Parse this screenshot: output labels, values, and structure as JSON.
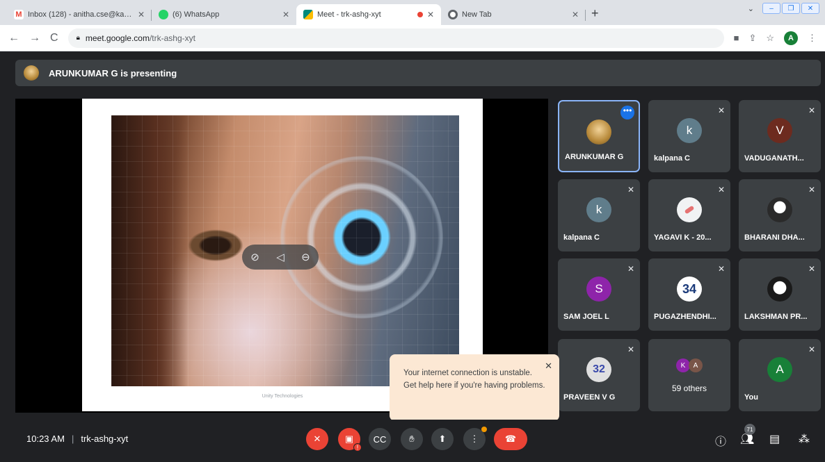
{
  "browser": {
    "tabs": [
      {
        "title": "Inbox (128) - anitha.cse@karpag",
        "icon": "gmail-icon",
        "color": "#ea4335"
      },
      {
        "title": "(6) WhatsApp",
        "icon": "whatsapp-icon",
        "color": "#25d366"
      },
      {
        "title": "Meet - trk-ashg-xyt",
        "icon": "meet-icon",
        "color": "#00897b"
      },
      {
        "title": "New Tab",
        "icon": "chrome-icon",
        "color": "#5f6368"
      }
    ],
    "url_host": "meet.google.com",
    "url_path": "/trk-ashg-xyt",
    "profile_initial": "A"
  },
  "presenting_banner": "ARUNKUMAR G is presenting",
  "slide_caption": "Unity Technologies",
  "participants": [
    {
      "name": "ARUNKUMAR G",
      "avatar": "",
      "avatar_color": "#b7893a",
      "muted": false
    },
    {
      "name": "kalpana C",
      "avatar": "k",
      "avatar_color": "#607d8b",
      "muted": true
    },
    {
      "name": "VADUGANATH...",
      "avatar": "V",
      "avatar_color": "#6d2b1f",
      "muted": true
    },
    {
      "name": "kalpana C",
      "avatar": "k",
      "avatar_color": "#607d8b",
      "muted": true
    },
    {
      "name": "YAGAVI K - 20...",
      "avatar": "",
      "avatar_color": "#f1f3f4",
      "muted": true
    },
    {
      "name": "BHARANI DHA...",
      "avatar": "",
      "avatar_color": "#2a2a2a",
      "muted": true
    },
    {
      "name": "SAM JOEL L",
      "avatar": "S",
      "avatar_color": "#8e24aa",
      "muted": true
    },
    {
      "name": "PUGAZHENDHI...",
      "avatar": "34",
      "avatar_color": "#ffffff",
      "muted": true
    },
    {
      "name": "LAKSHMAN PR...",
      "avatar": "",
      "avatar_color": "#1a1a1a",
      "muted": true
    },
    {
      "name": "PRAVEEN V G",
      "avatar": "32",
      "avatar_color": "#e0e0e0",
      "muted": true
    },
    {
      "name": "You",
      "avatar": "A",
      "avatar_color": "#188038",
      "muted": true
    }
  ],
  "others": {
    "label": "59 others",
    "initials": [
      "K",
      "A"
    ]
  },
  "tooltip": "Your internet connection is unstable. Get help here if you're having problems.",
  "meeting": {
    "time": "10:23 AM",
    "code": "trk-ashg-xyt"
  },
  "people_count": "71"
}
